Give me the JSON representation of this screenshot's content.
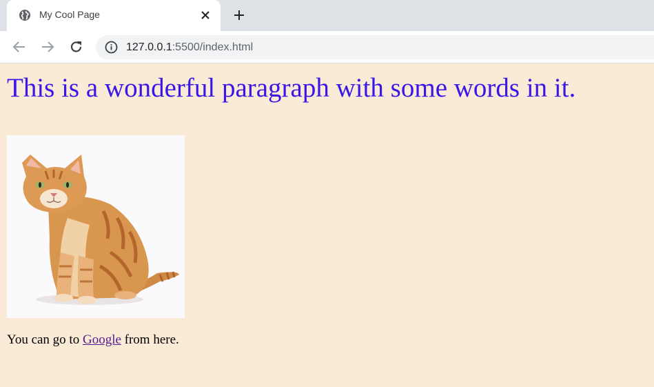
{
  "browser": {
    "tab": {
      "title": "My Cool Page",
      "favicon": "globe-icon",
      "close_icon": "close-icon"
    },
    "new_tab_icon": "plus-icon",
    "toolbar": {
      "back_icon": "back-arrow-icon",
      "forward_icon": "forward-arrow-icon",
      "reload_icon": "reload-icon",
      "site_info_icon": "info-icon",
      "url_host": "127.0.0.1",
      "url_path": ":5500/index.html"
    }
  },
  "page": {
    "background_color": "#faebd7",
    "headline": "This is a wonderful paragraph with some words in it.",
    "headline_color": "#3a17e6",
    "image": {
      "subject": "orange tabby cat sitting"
    },
    "text_before_link": "You can go to ",
    "link_text": "Google",
    "text_after_link": " from here.",
    "link_color": "#551a8b"
  }
}
